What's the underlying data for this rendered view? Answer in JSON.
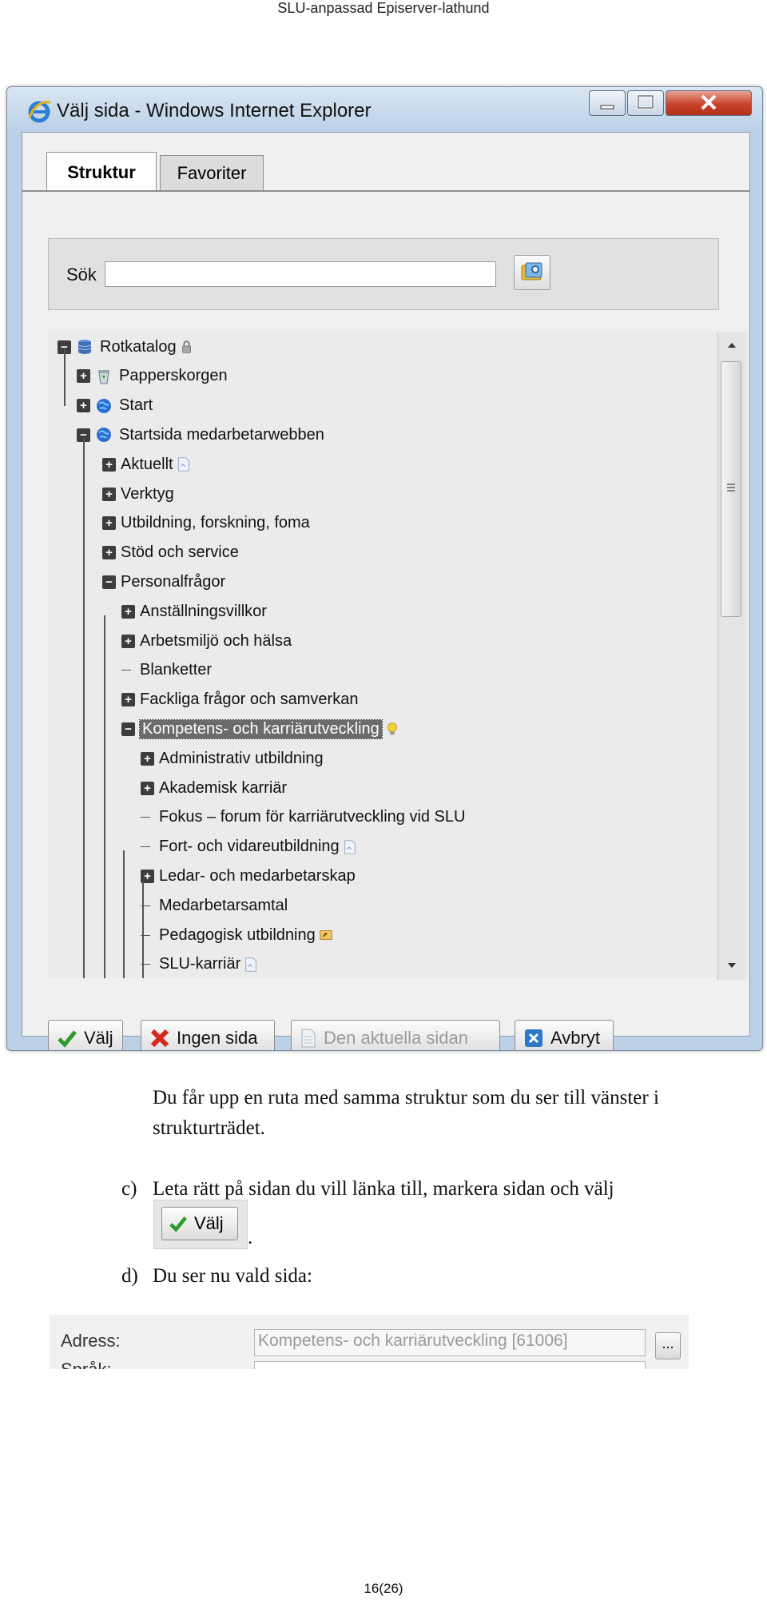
{
  "header": {
    "text": "SLU-anpassad Episerver-lathund"
  },
  "window": {
    "title": "Välj sida - Windows Internet Explorer",
    "tabs": [
      "Struktur",
      "Favoriter"
    ],
    "search_label": "Sök",
    "search_value": "",
    "tree": {
      "items": [
        {
          "label": "Rotkatalog",
          "level": 0,
          "state": "expanded",
          "icon": "database-icon",
          "suffix": "lock-icon"
        },
        {
          "label": "Papperskorgen",
          "level": 1,
          "state": "collapsed",
          "icon": "recycle-bin-icon"
        },
        {
          "label": "Start",
          "level": 1,
          "state": "collapsed",
          "icon": "globe-icon"
        },
        {
          "label": "Startsida medarbetarwebben",
          "level": 1,
          "state": "expanded",
          "icon": "globe-icon"
        },
        {
          "label": "Aktuellt",
          "level": 2,
          "state": "collapsed",
          "suffix": "page-icon"
        },
        {
          "label": "Verktyg",
          "level": 2,
          "state": "collapsed"
        },
        {
          "label": "Utbildning, forskning, foma",
          "level": 2,
          "state": "collapsed"
        },
        {
          "label": "Stöd och service",
          "level": 2,
          "state": "collapsed"
        },
        {
          "label": "Personalfrågor",
          "level": 2,
          "state": "expanded"
        },
        {
          "label": "Anställningsvillkor",
          "level": 3,
          "state": "collapsed"
        },
        {
          "label": "Arbetsmiljö och hälsa",
          "level": 3,
          "state": "collapsed"
        },
        {
          "label": "Blanketter",
          "level": 3,
          "state": "leaf"
        },
        {
          "label": "Fackliga frågor och samverkan",
          "level": 3,
          "state": "collapsed"
        },
        {
          "label": "Kompetens- och karriärutveckling",
          "level": 3,
          "state": "expanded",
          "selected": true,
          "suffix": "lightbulb-icon"
        },
        {
          "label": "Administrativ utbildning",
          "level": 4,
          "state": "collapsed"
        },
        {
          "label": "Akademisk karriär",
          "level": 4,
          "state": "collapsed"
        },
        {
          "label": "Fokus – forum för karriärutveckling vid SLU",
          "level": 4,
          "state": "leaf"
        },
        {
          "label": "Fort- och vidareutbildning",
          "level": 4,
          "state": "leaf",
          "suffix": "page-icon"
        },
        {
          "label": "Ledar- och medarbetarskap",
          "level": 4,
          "state": "collapsed"
        },
        {
          "label": "Medarbetarsamtal",
          "level": 4,
          "state": "leaf"
        },
        {
          "label": "Pedagogisk utbildning",
          "level": 4,
          "state": "leaf",
          "suffix": "shortcut-icon"
        },
        {
          "label": "SLU-karriär",
          "level": 4,
          "state": "leaf",
          "suffix": "page-icon"
        }
      ]
    },
    "buttons": {
      "valj": "Välj",
      "ingen_sida": "Ingen sida",
      "den_aktuella_sidan": "Den aktuella sidan",
      "avbryt": "Avbryt"
    }
  },
  "doc": {
    "paragraph": "Du får upp en ruta med samma struktur som du ser till vänster i strukturträdet.",
    "step_c_marker": "c)",
    "step_c_text": "Leta rätt på sidan du vill länka till, markera sidan och välj",
    "step_c_button": "Välj",
    "step_c_period": ".",
    "step_d_marker": "d)",
    "step_d_text": "Du ser nu vald sida:"
  },
  "address": {
    "label": "Adress:",
    "value": "Kompetens- och karriärutveckling [61006]",
    "browse_label": "...",
    "label2": "Språk:"
  },
  "footer": {
    "page_number": "16(26)"
  },
  "colors": {
    "selection": "#6b6b6b",
    "check_green": "#2e9b2e",
    "cross_red": "#d8261b",
    "cancel_blue": "#2c78c8"
  }
}
